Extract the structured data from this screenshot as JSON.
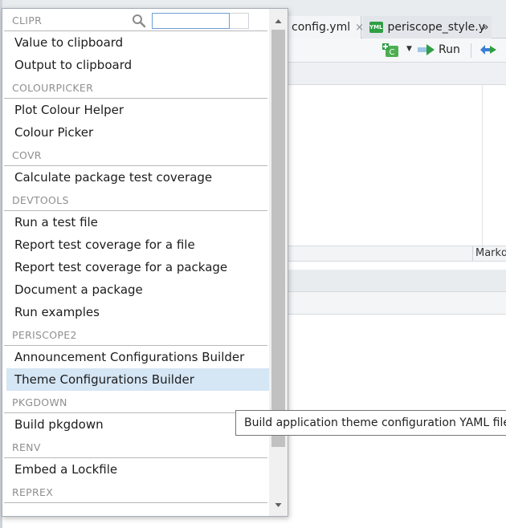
{
  "editor": {
    "tabs": [
      {
        "label": "config.yml",
        "close": "×"
      },
      {
        "label": "periscope_style.y",
        "badge": "YML"
      }
    ],
    "tabs_overflow": "»",
    "toolbar": {
      "run_label": "Run",
      "insert_badge": "C"
    },
    "status_mode": "Markd"
  },
  "addins": {
    "search": {
      "value": "",
      "placeholder": ""
    },
    "groups": [
      {
        "header": "CLIPR",
        "items": [
          "Value to clipboard",
          "Output to clipboard"
        ]
      },
      {
        "header": "COLOURPICKER",
        "items": [
          "Plot Colour Helper",
          "Colour Picker"
        ]
      },
      {
        "header": "COVR",
        "items": [
          "Calculate package test coverage"
        ]
      },
      {
        "header": "DEVTOOLS",
        "items": [
          "Run a test file",
          "Report test coverage for a file",
          "Report test coverage for a package",
          "Document a package",
          "Run examples"
        ]
      },
      {
        "header": "PERISCOPE2",
        "items": [
          "Announcement Configurations Builder",
          "Theme Configurations Builder"
        ]
      },
      {
        "header": "PKGDOWN",
        "items": [
          "Build pkgdown"
        ]
      },
      {
        "header": "RENV",
        "items": [
          "Embed a Lockfile"
        ]
      },
      {
        "header": "REPREX",
        "items": []
      }
    ],
    "highlighted_item": "Theme Configurations Builder",
    "tooltip": "Build application theme configuration YAML file"
  },
  "colors": {
    "highlight": "#d5e6f5",
    "section_text": "#8f8f8f",
    "search_border": "#6aa0d8",
    "run_arrow": "#2f9e44"
  }
}
